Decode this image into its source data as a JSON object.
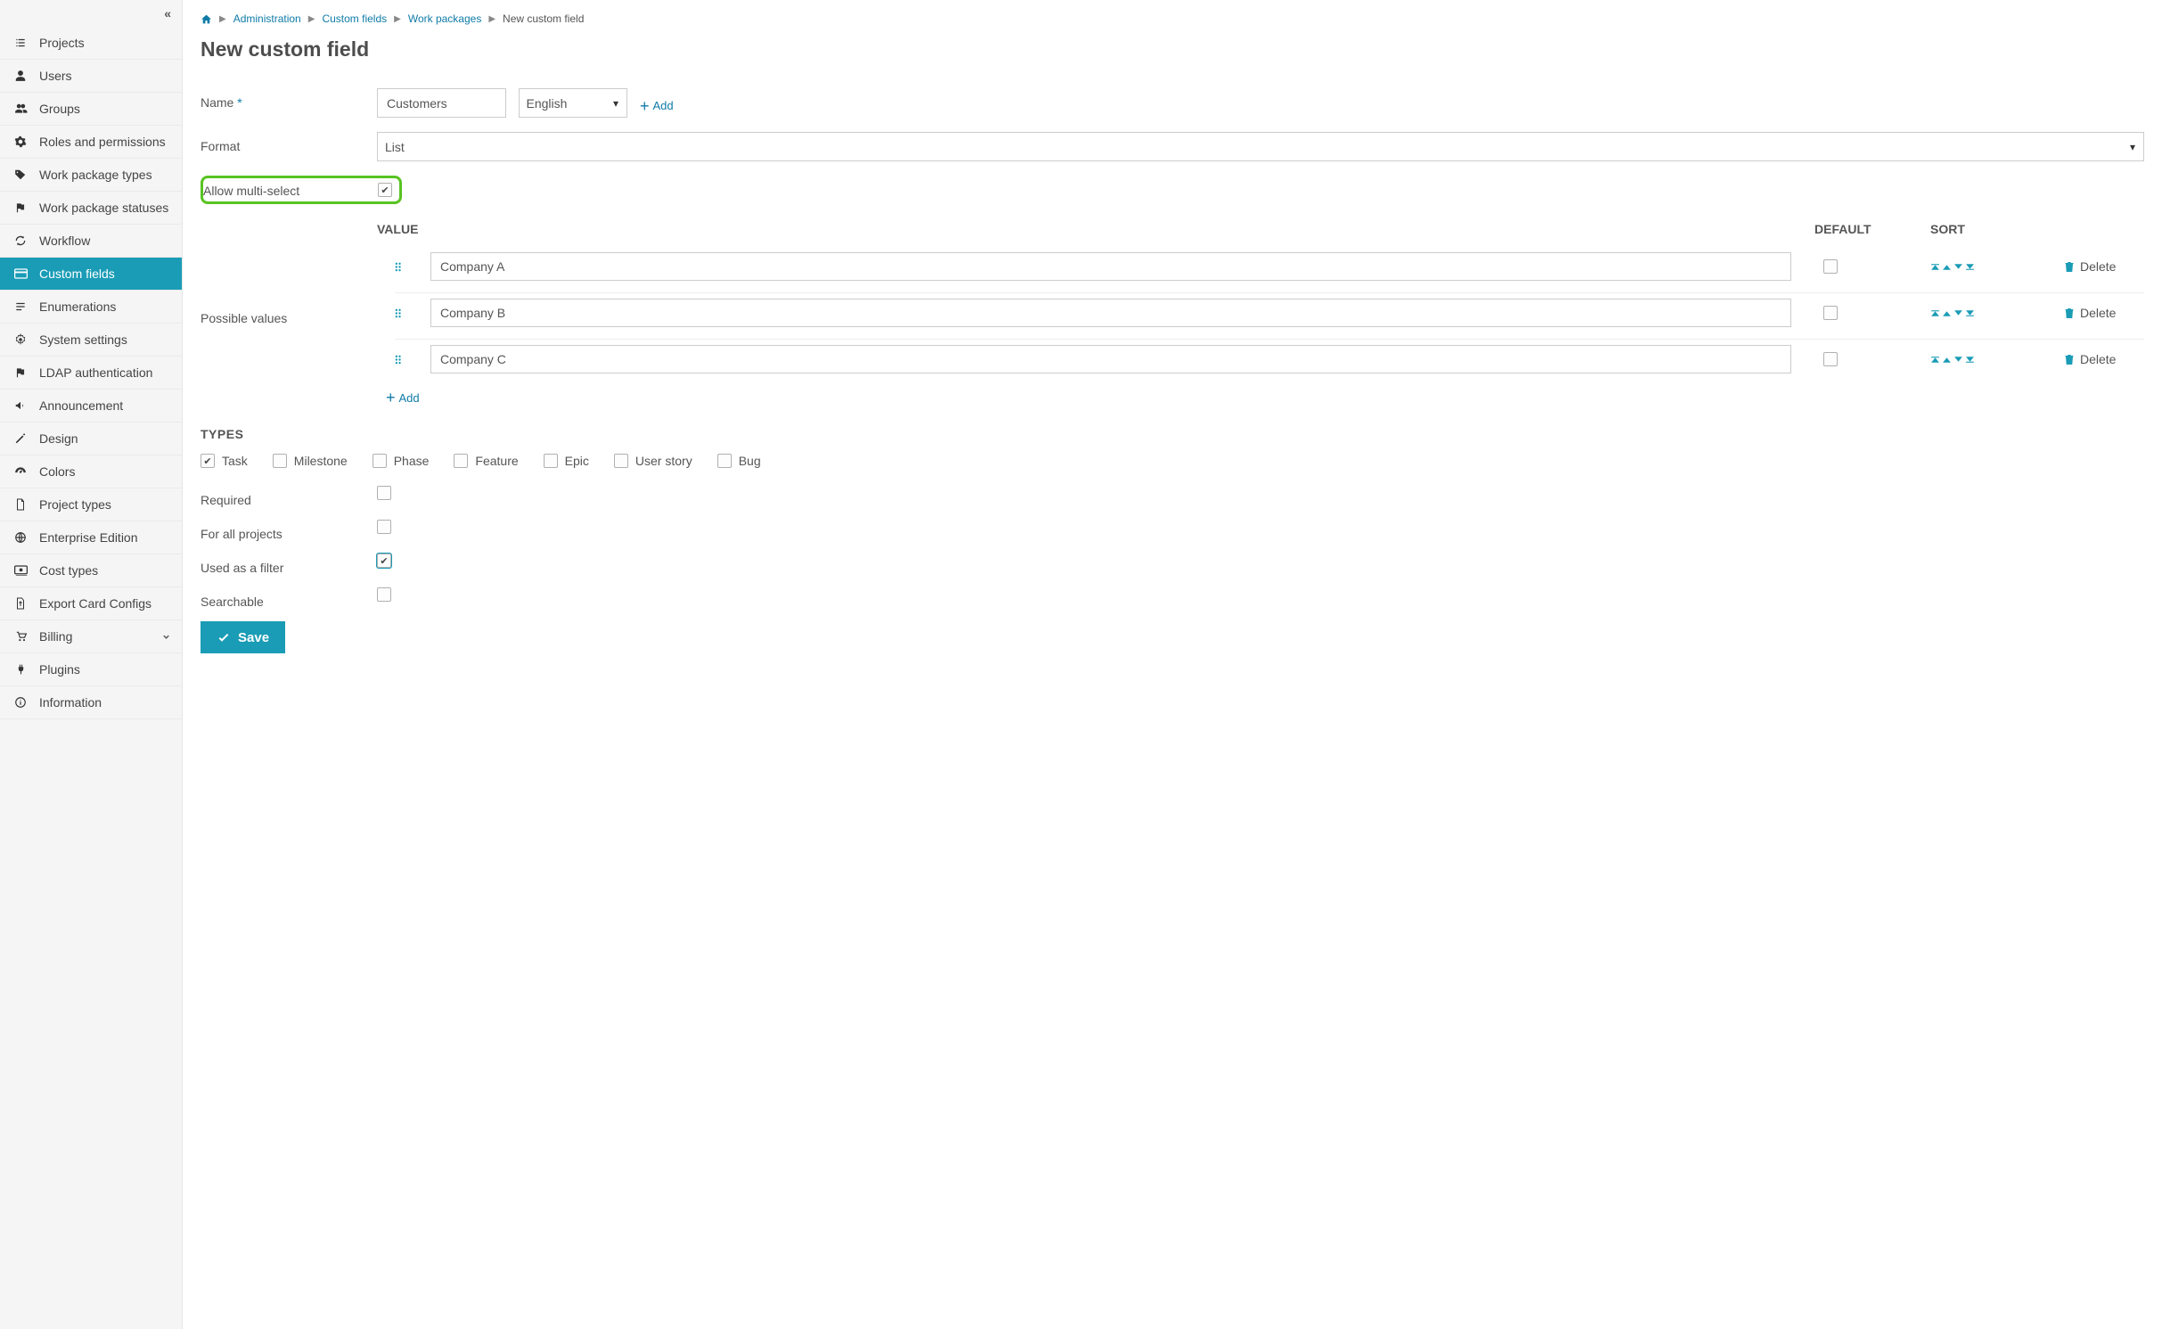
{
  "sidebar": {
    "items": [
      {
        "label": "Projects",
        "icon": "list-icon"
      },
      {
        "label": "Users",
        "icon": "user-icon"
      },
      {
        "label": "Groups",
        "icon": "users-icon"
      },
      {
        "label": "Roles and permissions",
        "icon": "gear-icon"
      },
      {
        "label": "Work package types",
        "icon": "tag-icon"
      },
      {
        "label": "Work package statuses",
        "icon": "flag-icon"
      },
      {
        "label": "Workflow",
        "icon": "refresh-icon"
      },
      {
        "label": "Custom fields",
        "icon": "card-icon",
        "active": true
      },
      {
        "label": "Enumerations",
        "icon": "lines-icon"
      },
      {
        "label": "System settings",
        "icon": "cog-icon"
      },
      {
        "label": "LDAP authentication",
        "icon": "flag-icon"
      },
      {
        "label": "Announcement",
        "icon": "megaphone-icon"
      },
      {
        "label": "Design",
        "icon": "pen-icon"
      },
      {
        "label": "Colors",
        "icon": "gauge-icon"
      },
      {
        "label": "Project types",
        "icon": "file-icon"
      },
      {
        "label": "Enterprise Edition",
        "icon": "globe-icon"
      },
      {
        "label": "Cost types",
        "icon": "money-icon"
      },
      {
        "label": "Export Card Configs",
        "icon": "export-icon"
      },
      {
        "label": "Billing",
        "icon": "cart-icon",
        "expandable": true
      },
      {
        "label": "Plugins",
        "icon": "plug-icon"
      },
      {
        "label": "Information",
        "icon": "info-icon"
      }
    ]
  },
  "breadcrumb": {
    "items": [
      {
        "label": "Administration"
      },
      {
        "label": "Custom fields"
      },
      {
        "label": "Work packages"
      }
    ],
    "current": "New custom field"
  },
  "page": {
    "title": "New custom field"
  },
  "form": {
    "name_label": "Name",
    "name_value": "Customers",
    "language_value": "English",
    "add_label": "Add",
    "format_label": "Format",
    "format_value": "List",
    "multi_label": "Allow multi-select",
    "multi_checked": true,
    "possible_label": "Possible values",
    "headers": {
      "value": "VALUE",
      "default": "DEFAULT",
      "sort": "SORT"
    },
    "values": [
      {
        "name": "Company A"
      },
      {
        "name": "Company B"
      },
      {
        "name": "Company C"
      }
    ],
    "add_value_label": "Add",
    "delete_label": "Delete",
    "types_title": "TYPES",
    "types": [
      {
        "label": "Task",
        "checked": true
      },
      {
        "label": "Milestone",
        "checked": false
      },
      {
        "label": "Phase",
        "checked": false
      },
      {
        "label": "Feature",
        "checked": false
      },
      {
        "label": "Epic",
        "checked": false
      },
      {
        "label": "User story",
        "checked": false
      },
      {
        "label": "Bug",
        "checked": false
      }
    ],
    "required_label": "Required",
    "required_checked": false,
    "for_all_label": "For all projects",
    "for_all_checked": false,
    "filter_label": "Used as a filter",
    "filter_checked": true,
    "searchable_label": "Searchable",
    "searchable_checked": false,
    "save_label": "Save"
  }
}
